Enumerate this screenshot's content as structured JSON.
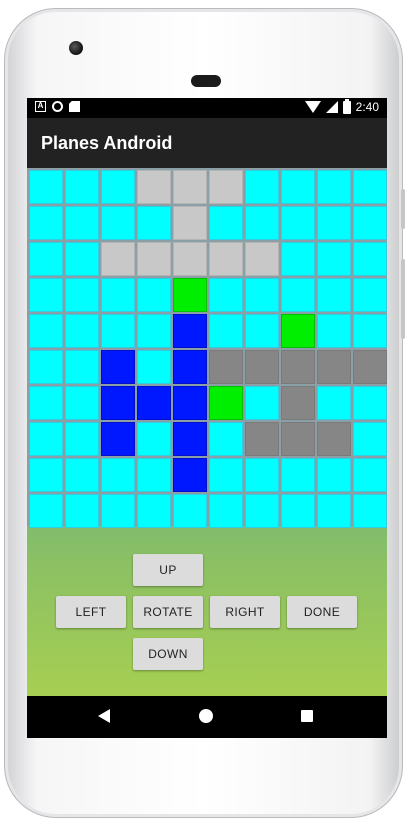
{
  "status_bar": {
    "time": "2:40",
    "left_icons": [
      "a-notification-icon",
      "circle-notification-icon",
      "sd-card-icon"
    ],
    "right_icons": [
      "wifi-icon",
      "signal-icon",
      "battery-icon"
    ]
  },
  "app_bar": {
    "title": "Planes Android"
  },
  "board": {
    "rows": 10,
    "cols": 10,
    "legend_colors": {
      "C": "#00ffff",
      "L": "#c8c8c8",
      "D": "#868686",
      "B": "#0018ff",
      "G": "#00ee00"
    },
    "cells": [
      [
        "C",
        "C",
        "C",
        "L",
        "L",
        "L",
        "C",
        "C",
        "C",
        "C"
      ],
      [
        "C",
        "C",
        "C",
        "C",
        "L",
        "C",
        "C",
        "C",
        "C",
        "C"
      ],
      [
        "C",
        "C",
        "L",
        "L",
        "L",
        "L",
        "L",
        "C",
        "C",
        "C"
      ],
      [
        "C",
        "C",
        "C",
        "C",
        "G",
        "C",
        "C",
        "C",
        "C",
        "C"
      ],
      [
        "C",
        "C",
        "C",
        "C",
        "B",
        "C",
        "C",
        "G",
        "C",
        "C"
      ],
      [
        "C",
        "C",
        "B",
        "C",
        "B",
        "D",
        "D",
        "D",
        "D",
        "D"
      ],
      [
        "C",
        "C",
        "B",
        "B",
        "B",
        "G",
        "C",
        "D",
        "C",
        "C"
      ],
      [
        "C",
        "C",
        "B",
        "C",
        "B",
        "C",
        "D",
        "D",
        "D",
        "C"
      ],
      [
        "C",
        "C",
        "C",
        "C",
        "B",
        "C",
        "C",
        "C",
        "C",
        "C"
      ],
      [
        "C",
        "C",
        "C",
        "C",
        "C",
        "C",
        "C",
        "C",
        "C",
        "C"
      ]
    ]
  },
  "controls": {
    "up": "UP",
    "left": "LEFT",
    "rotate": "ROTATE",
    "right": "RIGHT",
    "done": "DONE",
    "down": "DOWN"
  },
  "nav_bar": {
    "icons": [
      "back-icon",
      "home-icon",
      "recents-icon"
    ]
  }
}
